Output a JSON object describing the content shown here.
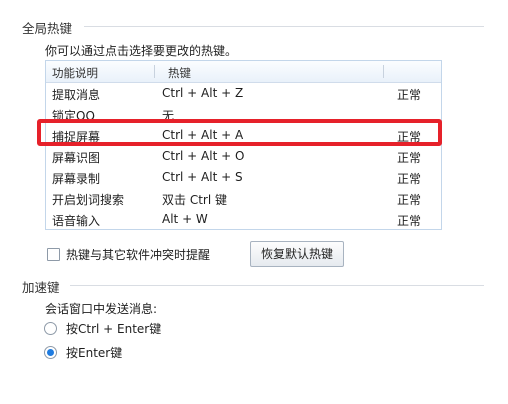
{
  "hotkeys": {
    "section_title": "全局热键",
    "intro": "你可以通过点击选择要更改的热键。",
    "columns": [
      "功能说明",
      "热键",
      ""
    ],
    "rows": [
      {
        "name": "提取消息",
        "key": "Ctrl + Alt + Z",
        "status": "正常"
      },
      {
        "name": "锁定QQ",
        "key": "无",
        "status": ""
      },
      {
        "name": "捕捉屏幕",
        "key": "Ctrl + Alt + A",
        "status": "正常"
      },
      {
        "name": "屏幕识图",
        "key": "Ctrl + Alt + O",
        "status": "正常"
      },
      {
        "name": "屏幕录制",
        "key": "Ctrl + Alt + S",
        "status": "正常"
      },
      {
        "name": "开启划词搜索",
        "key": "双击 Ctrl 键",
        "status": "正常"
      },
      {
        "name": "语音输入",
        "key": "Alt + W",
        "status": "正常"
      }
    ],
    "highlighted_row": "捕捉屏幕",
    "conflict_checkbox_label": "热键与其它软件冲突时提醒",
    "conflict_checked": false,
    "restore_button": "恢复默认热键"
  },
  "accelerator": {
    "section_title": "加速键",
    "send_label": "会话窗口中发送消息:",
    "options": [
      {
        "label": "按Ctrl + Enter键",
        "selected": false
      },
      {
        "label": "按Enter键",
        "selected": true
      }
    ]
  },
  "colors": {
    "highlight_border": "#e6212a",
    "radio_selected": "#1f7ce0",
    "table_border": "#c3d6ea"
  }
}
